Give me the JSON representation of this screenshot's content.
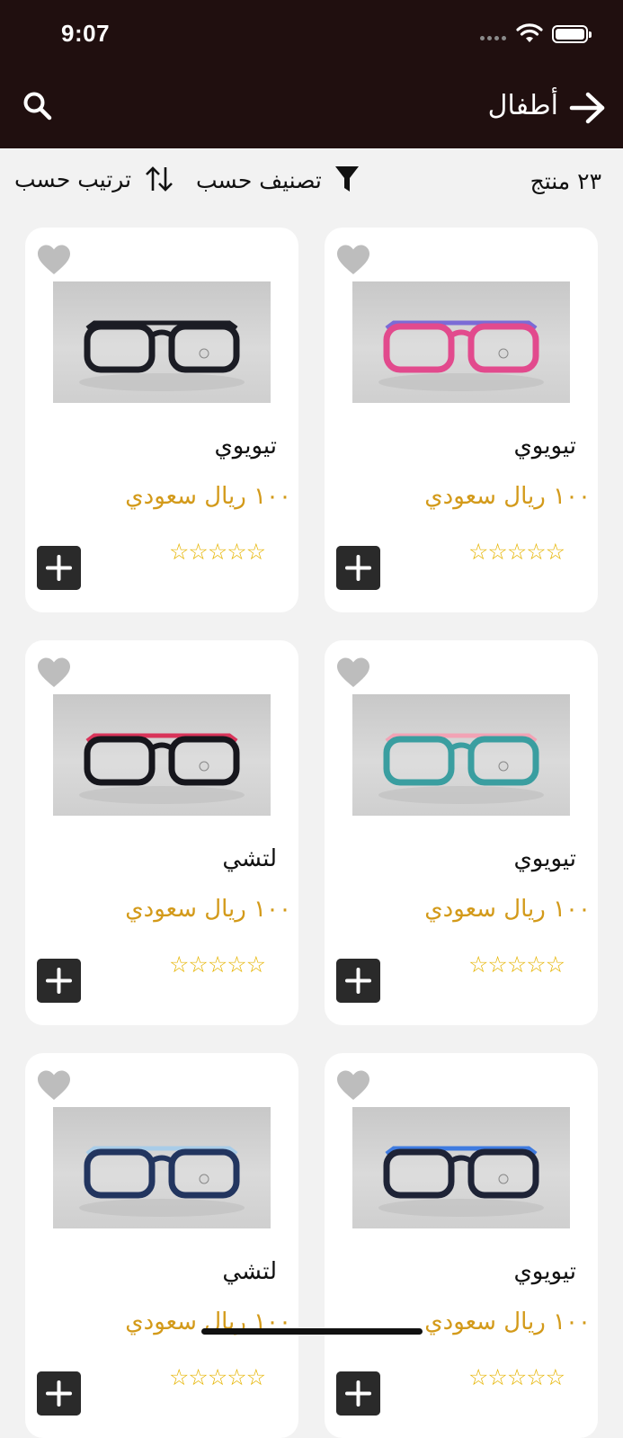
{
  "status_bar": {
    "time": "9:07"
  },
  "header": {
    "title": "أطفال",
    "background": "#200f0f"
  },
  "filters": {
    "count": "٢٣ منتج",
    "classify_label": "تصنيف حسب",
    "sort_label": "ترتيب حسب"
  },
  "accent_price_color": "#d39a1a",
  "products": [
    {
      "name": "تيويوي",
      "price": "١٠٠ ريال سعودي",
      "stars": "☆☆☆☆☆",
      "frame_color": "#e24a8d",
      "temple_color": "#7b6bd6"
    },
    {
      "name": "تيويوي",
      "price": "١٠٠ ريال سعودي",
      "stars": "☆☆☆☆☆",
      "frame_color": "#1b1c24",
      "temple_color": "#1b1c24"
    },
    {
      "name": "تيويوي",
      "price": "١٠٠ ريال سعودي",
      "stars": "☆☆☆☆☆",
      "frame_color": "#3a9ea0",
      "temple_color": "#f2a3b5"
    },
    {
      "name": "لتشي",
      "price": "١٠٠ ريال سعودي",
      "stars": "☆☆☆☆☆",
      "frame_color": "#16161c",
      "temple_color": "#d9345a"
    },
    {
      "name": "تيويوي",
      "price": "١٠٠ ريال سعودي",
      "stars": "☆☆☆☆☆",
      "frame_color": "#1e2336",
      "temple_color": "#3f7be0"
    },
    {
      "name": "لتشي",
      "price": "١٠٠ ريال سعودي",
      "stars": "☆☆☆☆☆",
      "frame_color": "#22355f",
      "temple_color": "#a8cce8"
    }
  ]
}
